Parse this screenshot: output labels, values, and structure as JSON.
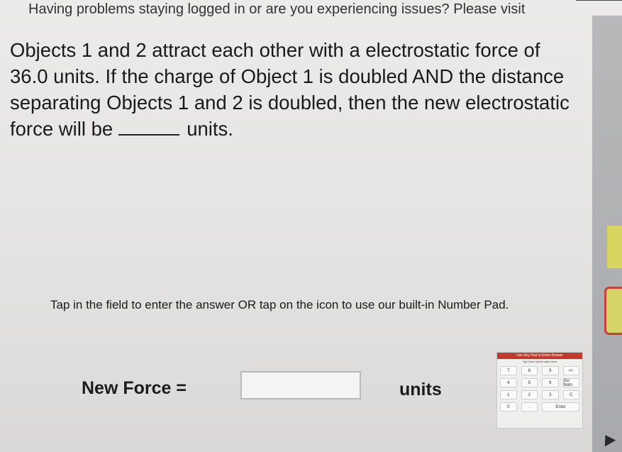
{
  "banner": {
    "text": "Having problems staying logged in or are you experiencing issues? Please visit"
  },
  "question": {
    "text_before": "Objects 1 and 2 attract each other with a electrostatic force of 36.0 units. If the charge of Object 1 is doubled AND the distance separating Objects 1 and 2 is doubled, then the new electrostatic force will be",
    "text_after": "units."
  },
  "instruction": {
    "text": "Tap in the field to enter the answer OR tap on the icon to use our built-in Number Pad."
  },
  "answer": {
    "label": "New Force =",
    "value": "",
    "units": "units"
  },
  "numpad": {
    "title": "Use Key Pad to Enter Answer",
    "subtitle": "Tap Enter button after done",
    "keys": [
      "7",
      "8",
      "9",
      "+/-",
      "4",
      "5",
      "6",
      "Sci Notn",
      "1",
      "2",
      "3",
      "C",
      "0",
      ".",
      "Enter"
    ]
  },
  "colors": {
    "numpad_header": "#c23a2c",
    "side_tab": "#d8d45f",
    "side_tab_border": "#c8413a"
  }
}
